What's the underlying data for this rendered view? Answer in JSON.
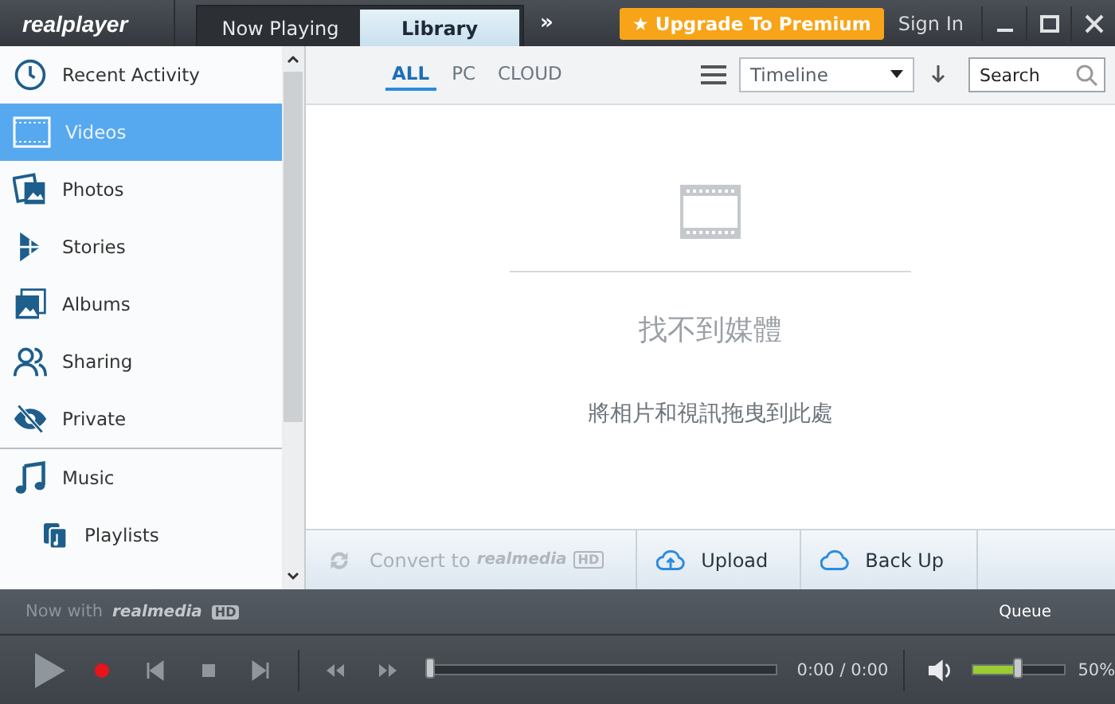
{
  "title_bar": {
    "logo": "realplayer",
    "tabs": [
      {
        "label": "Now Playing",
        "selected": false
      },
      {
        "label": "Library",
        "selected": true
      }
    ],
    "more": "»",
    "upgrade": "★ Upgrade To Premium",
    "sign_in": "Sign In"
  },
  "sidebar": {
    "items": [
      {
        "label": "Recent Activity",
        "kind": "clock",
        "selected": false
      },
      {
        "label": "Videos",
        "kind": "film",
        "selected": true
      },
      {
        "label": "Photos",
        "kind": "photos",
        "selected": false
      },
      {
        "label": "Stories",
        "kind": "stories",
        "selected": false
      },
      {
        "label": "Albums",
        "kind": "album",
        "selected": false
      },
      {
        "label": "Sharing",
        "kind": "people",
        "selected": false
      },
      {
        "label": "Private",
        "kind": "eye",
        "selected": false
      },
      {
        "label": "Music",
        "kind": "note",
        "selected": false,
        "children": [
          {
            "label": "Playlists",
            "kind": "playlist",
            "selected": false
          }
        ]
      }
    ]
  },
  "toolbar": {
    "filters": [
      {
        "label": "ALL",
        "selected": true
      },
      {
        "label": "PC",
        "selected": false
      },
      {
        "label": "CLOUD",
        "selected": false
      }
    ],
    "sort": {
      "value": "Timeline"
    },
    "search": {
      "placeholder": "Search"
    }
  },
  "empty_state": {
    "title": "找不到媒體",
    "hint": "將相片和視訊拖曳到此處"
  },
  "actions": [
    {
      "label": "Convert to",
      "kind": "convert",
      "disabled": true,
      "logo": "realmedia",
      "badge": "HD"
    },
    {
      "label": "Upload",
      "kind": "upload",
      "disabled": false
    },
    {
      "label": "Back Up",
      "kind": "backup",
      "disabled": false
    }
  ],
  "player": {
    "promo": "Now with",
    "promo_logo": "realmedia",
    "promo_badge": "HD",
    "queue": "Queue",
    "time": "0:00 / 0:00",
    "progress": {
      "level": 0
    },
    "volume": {
      "level": 0.5,
      "reading": "50%"
    }
  }
}
